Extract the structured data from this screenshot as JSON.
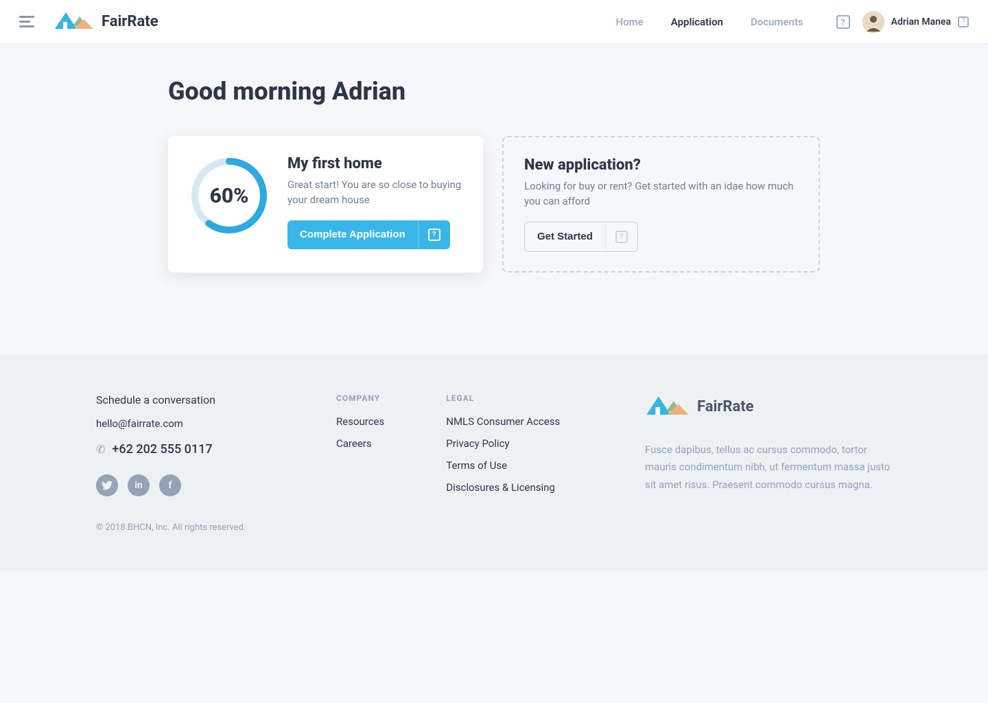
{
  "brand": "FairRate",
  "nav": {
    "items": [
      {
        "label": "Home",
        "active": false
      },
      {
        "label": "Application",
        "active": true
      },
      {
        "label": "Documents",
        "active": false
      }
    ]
  },
  "user": {
    "name": "Adrian Manea"
  },
  "greeting": "Good morning Adrian",
  "cards": {
    "progress": {
      "title": "My first home",
      "desc": "Great start! You are so close to buying your dream house",
      "percent": "60%",
      "button": "Complete Application"
    },
    "new": {
      "title": "New application?",
      "desc": "Looking for buy or rent? Get started with an idae how much you can afford",
      "button": "Get Started"
    }
  },
  "footer": {
    "schedule": "Schedule a conversation",
    "email": "hello@fairrate.com",
    "phone": "+62 202 555 0117",
    "copyright": "© 2018 BHCN, Inc. All rights reserved.",
    "company_heading": "COMPANY",
    "company": [
      "Resources",
      "Careers"
    ],
    "legal_heading": "LEGAL",
    "legal": [
      "NMLS Consumer Access",
      "Privacy Policy",
      "Terms of Use",
      "Disclosures & Licensing"
    ],
    "blurb": "Fusce dapibus, tellus ac cursus commodo, tortor mauris condimentum nibh, ut fermentum massa justo sit amet risus. Praesent commodo cursus magna."
  }
}
